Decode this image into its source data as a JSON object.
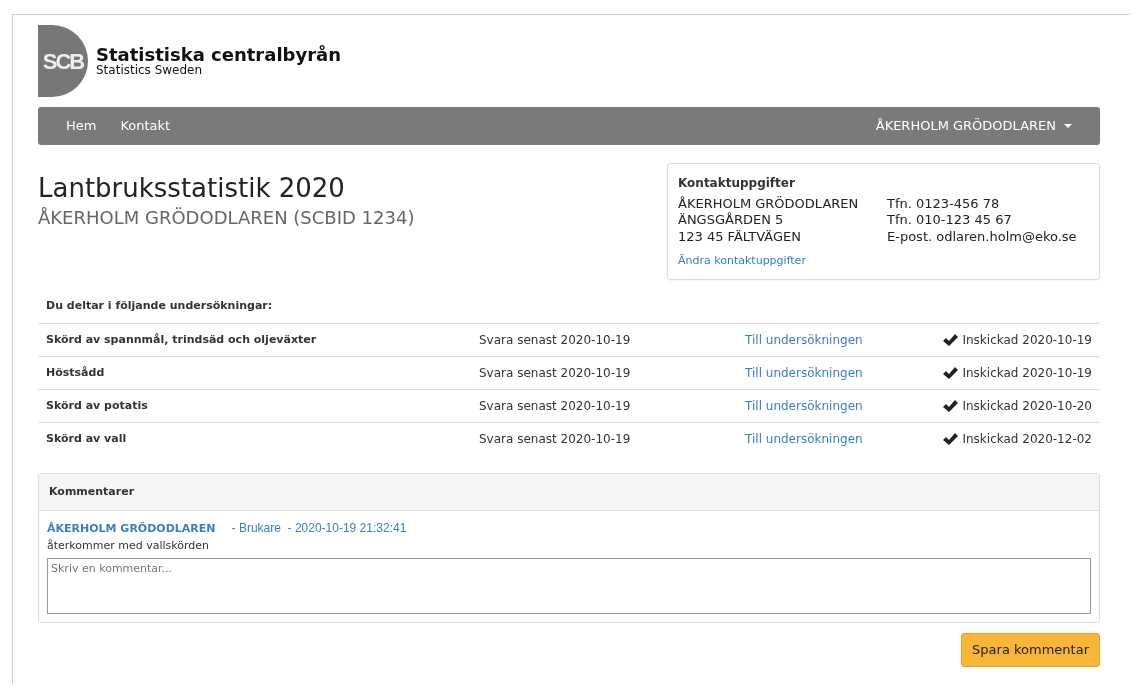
{
  "logo": {
    "mark": "SCB",
    "name": "Statistiska centralbyrån",
    "subtitle": "Statistics Sweden"
  },
  "navbar": {
    "links": [
      "Hem",
      "Kontakt"
    ],
    "user_menu": "ÅKERHOLM GRÖDODLAREN"
  },
  "page": {
    "title": "Lantbruksstatistik 2020",
    "subtitle": "ÅKERHOLM GRÖDODLAREN (SCBID 1234)"
  },
  "contact": {
    "heading": "Kontaktuppgifter",
    "address": [
      "ÅKERHOLM GRÖDODLAREN",
      "ÄNGSGÅRDEN 5",
      "123 45 FÄLTVÄGEN"
    ],
    "details": [
      "Tfn. 0123-456 78",
      "Tfn. 010-123 45 67",
      "E-post. odlaren.holm@eko.se"
    ],
    "edit_link": "Ändra kontaktuppgifter"
  },
  "surveys": {
    "heading": "Du deltar i följande undersökningar:",
    "rows": [
      {
        "name": "Skörd av spannmål, trindsäd och oljeväxter",
        "deadline": "Svara senast 2020-10-19",
        "link": "Till undersökningen",
        "submitted": true,
        "status": "Inskickad 2020-10-19"
      },
      {
        "name": "Höstsådd",
        "deadline": "Svara senast 2020-10-19",
        "link": "Till undersökningen",
        "submitted": true,
        "status": "Inskickad 2020-10-19"
      },
      {
        "name": "Skörd av potatis",
        "deadline": "Svara senast 2020-10-19",
        "link": "Till undersökningen",
        "submitted": true,
        "status": "Inskickad 2020-10-20"
      },
      {
        "name": "Skörd av vall",
        "deadline": "Svara senast 2020-10-19",
        "link": "Till undersökningen",
        "submitted": true,
        "status": "Inskickad 2020-12-02"
      }
    ]
  },
  "comments": {
    "heading": "Kommentarer",
    "items": [
      {
        "author": "ÅKERHOLM GRÖDODLAREN",
        "meta": "- Brukare  - 2020-10-19 21:32:41",
        "text": "återkommer med vallskörden"
      }
    ],
    "placeholder": "Skriv en kommentar...",
    "save_button": "Spara kommentar"
  }
}
